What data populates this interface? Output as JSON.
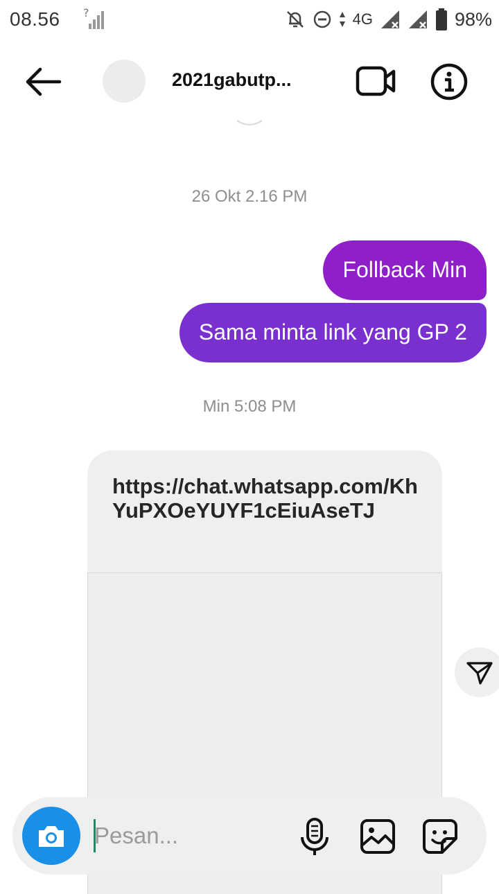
{
  "status_bar": {
    "time": "08.56",
    "network": "4G",
    "battery": "98%",
    "icons": [
      "no-sim-signal-icon",
      "mute-notifications-icon",
      "do-not-disturb-icon",
      "data-arrows-icon",
      "signal-1-icon",
      "signal-2-icon",
      "battery-icon"
    ]
  },
  "header": {
    "title": "2021gabutp...",
    "icons": [
      "back-arrow-icon",
      "video-call-icon",
      "info-icon"
    ]
  },
  "conversation": {
    "timestamp_1": "26 Okt 2.16 PM",
    "sent_messages": [
      "Follback Min",
      "Sama minta link yang GP 2"
    ],
    "timestamp_2": "Min 5:08 PM",
    "received_link": "https://chat.whatsapp.com/KhYuPXOeYUYF1cEiuAseTJ"
  },
  "composer": {
    "placeholder": "Pesan...",
    "icons": [
      "camera-icon",
      "microphone-icon",
      "gallery-icon",
      "sticker-icon"
    ]
  },
  "colors": {
    "bubble_top": "#8e1fc9",
    "bubble_bottom": "#7a2fcf",
    "camera_button": "#1a8fe8"
  }
}
